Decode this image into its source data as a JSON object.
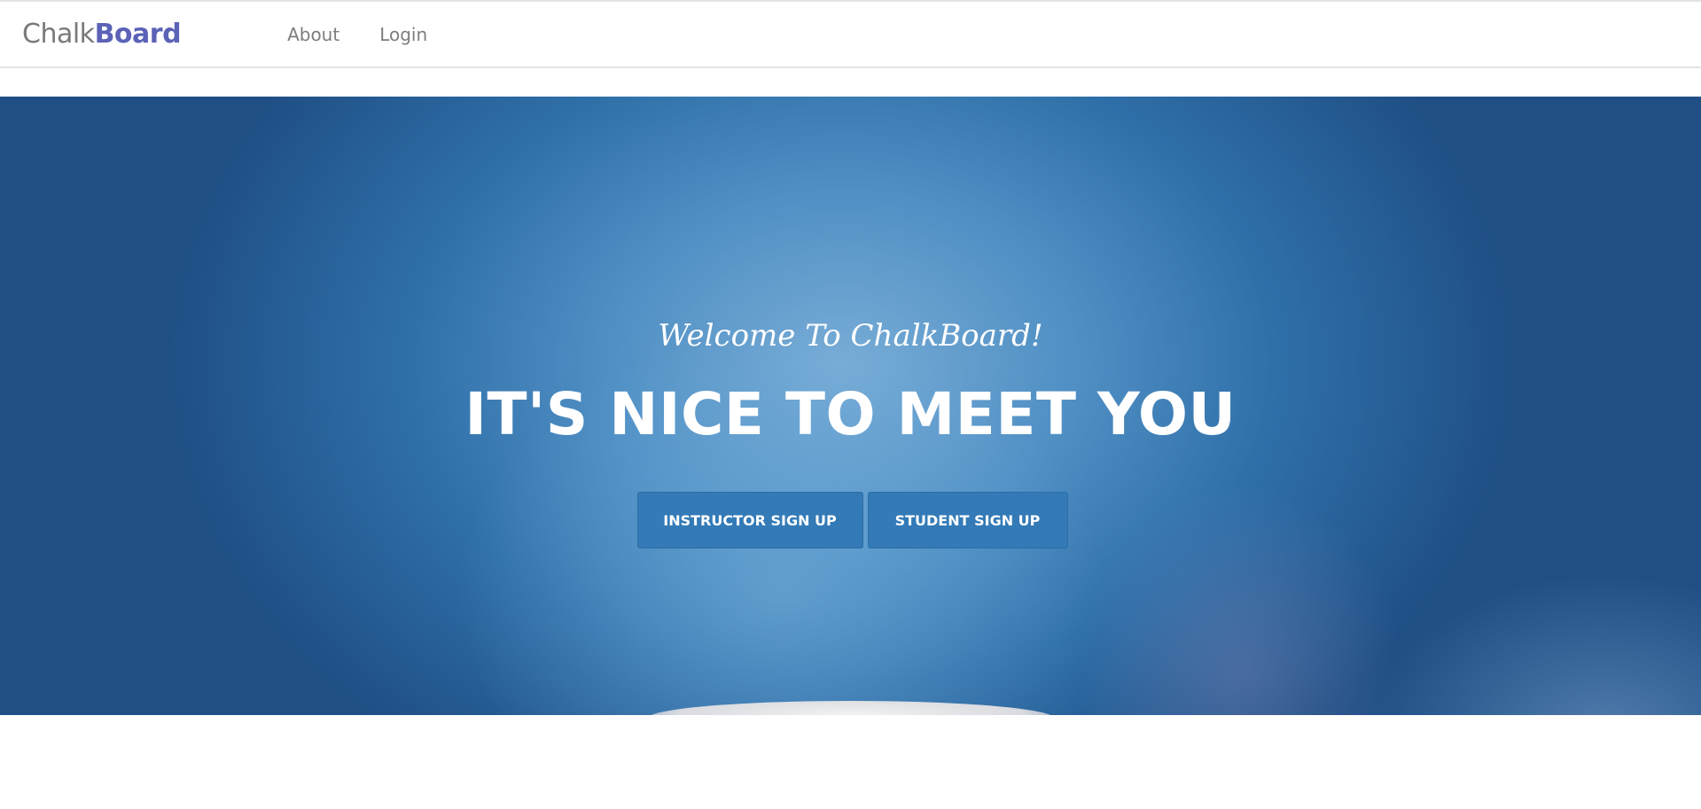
{
  "brand": {
    "light": "Chalk",
    "bold": "Board"
  },
  "nav": {
    "items": [
      {
        "label": "About"
      },
      {
        "label": "Login"
      }
    ]
  },
  "hero": {
    "subtitle": "Welcome To ChalkBoard!",
    "title": "IT'S NICE TO MEET YOU",
    "buttons": {
      "instructor": "INSTRUCTOR SIGN UP",
      "student": "STUDENT SIGN UP"
    }
  },
  "colors": {
    "brand_accent": "#5b62b7",
    "button_bg": "#337ab7",
    "hero_blue": "#2f6fa8"
  }
}
